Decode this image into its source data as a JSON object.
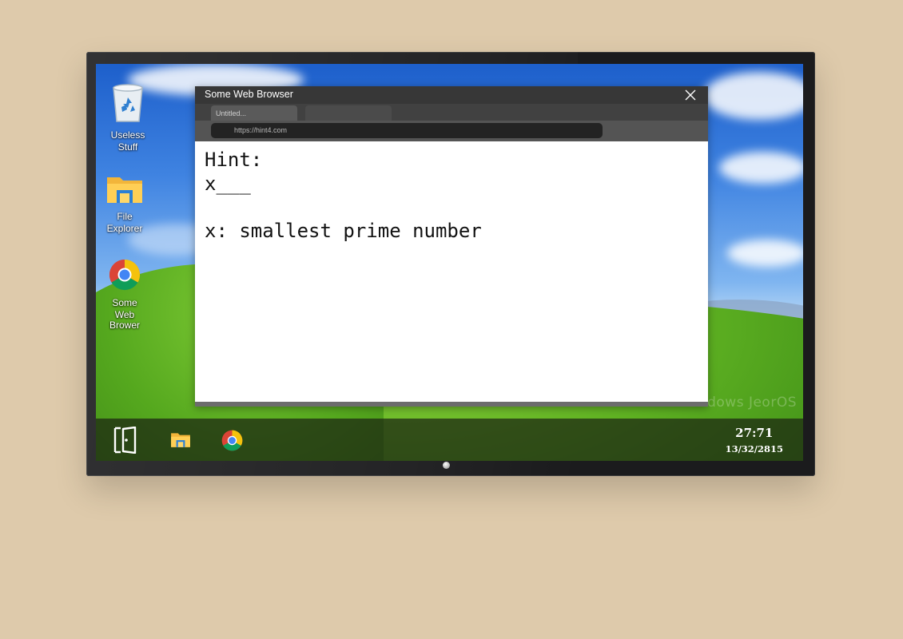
{
  "desktop": {
    "icons": [
      {
        "label_1": "Useless",
        "label_2": "Stuff",
        "icon": "recycle-bin-icon"
      },
      {
        "label_1": "File",
        "label_2": "Explorer",
        "icon": "folder-icon"
      },
      {
        "label_1": "Some",
        "label_2": "Web",
        "label_3": "Brower",
        "icon": "chrome-icon"
      }
    ],
    "watermark": "...dows JeorOS"
  },
  "browser": {
    "title": "Some Web Browser",
    "tabs": [
      {
        "label": "Untitled..."
      },
      {
        "label": ""
      }
    ],
    "url": "https://hint4.com",
    "content": {
      "line1": "Hint:",
      "line2": "x___",
      "line3": "x: smallest prime number"
    }
  },
  "taskbar": {
    "icons": [
      "exit-door-icon",
      "folder-icon",
      "chrome-icon"
    ],
    "time": "27:71",
    "date": "13/32/2815"
  },
  "colors": {
    "background": "#decaab",
    "titlebar": "#373737",
    "taskbar": "#1c2412"
  }
}
